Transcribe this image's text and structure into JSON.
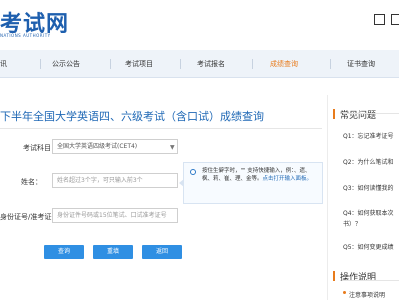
{
  "header": {
    "logo_text": "考试网",
    "logo_subtitle": "NATIONS AUTHORITY"
  },
  "nav": {
    "items": [
      "考试报名",
      "成绩查询",
      "证书查询"
    ],
    "partial_first": "讯",
    "second": "公示公告",
    "third": "考试项目",
    "active": "成绩查询"
  },
  "page": {
    "title": "下半年全国大学英语四、六级考试（含口试）成绩查询"
  },
  "form": {
    "subject_label": "考试科目：",
    "subject_value": "全国大学英语四级考试(CET4)",
    "name_label": "姓名：",
    "name_placeholder": "姓名超过3个字，可只输入前3个",
    "id_label": "身份证号/准考证号：",
    "id_placeholder": "身份证件号码或15位笔试、口试准考证号"
  },
  "tip": {
    "text": "按住生僻字时，\"\" 支持快捷输入，例：、遗、枫、莉、崔、理、金等。",
    "link": "点击打开输入面板。"
  },
  "buttons": {
    "query": "查询",
    "reset": "重填",
    "back": "返回"
  },
  "sidebar": {
    "faq_title": "常见问题",
    "faq": [
      "Q1：忘记准考证号",
      "Q2：为什么笔试和",
      "Q3：如何读懂我的",
      "Q4：如何获取本次",
      "书）？",
      "Q5：如何变更成绩"
    ],
    "ops_title": "操作说明",
    "ops_first": "注意事项说明"
  }
}
